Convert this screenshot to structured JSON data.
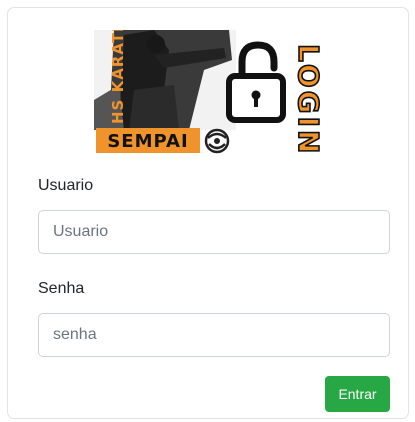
{
  "logo": {
    "brand_vertical": "HS KARATE",
    "brand_banner": "SEMPAI",
    "side_text": "LOGIN",
    "lock_icon": "padlock-open-icon",
    "emblem_icon": "karate-emblem-icon",
    "colors": {
      "orange": "#f0932b",
      "dark": "#111111"
    }
  },
  "form": {
    "username_label": "Usuario",
    "username_placeholder": "Usuario",
    "password_label": "Senha",
    "password_placeholder": "senha",
    "submit_label": "Entrar",
    "submit_color": "#28a745"
  }
}
